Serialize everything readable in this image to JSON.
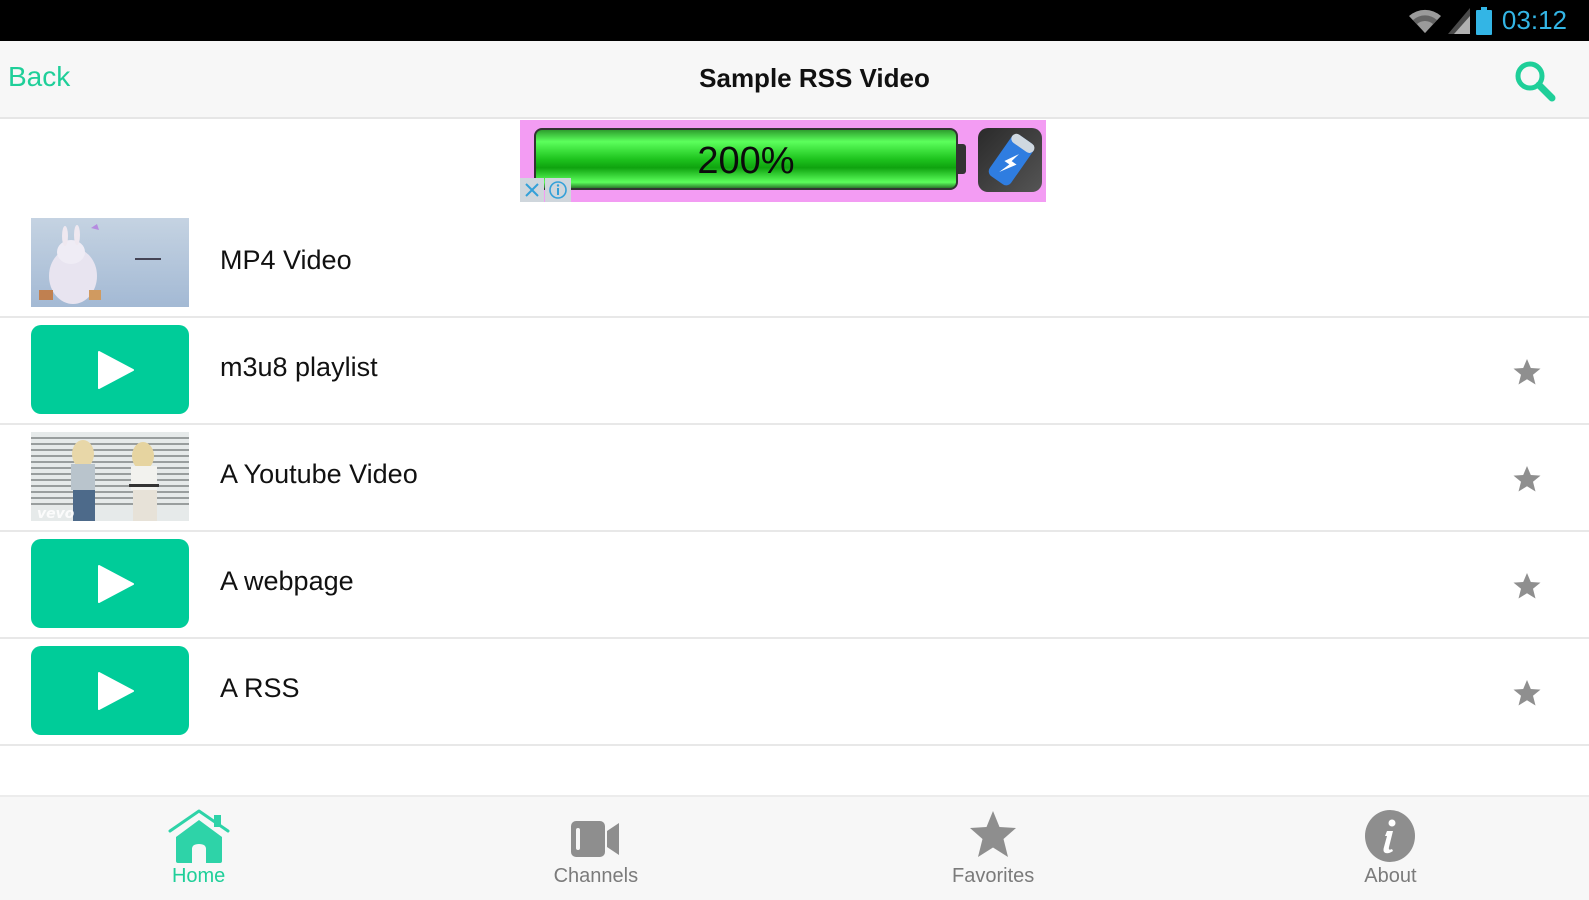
{
  "status_bar": {
    "time": "03:12",
    "icons": [
      "wifi-icon",
      "signal-icon",
      "battery-icon"
    ],
    "time_color": "#33b5e5"
  },
  "app_bar": {
    "back_label": "Back",
    "title": "Sample RSS Video",
    "search_icon": "search-icon",
    "accent_color": "#1fcf99"
  },
  "ad": {
    "text": "200%",
    "close_icon": "close-icon",
    "info_icon": "info-icon",
    "app_icon": "battery-app-icon"
  },
  "list": {
    "items": [
      {
        "title": "MP4 Video",
        "thumbnail": "video-thumbnail-bunny",
        "favorite": false
      },
      {
        "title": "m3u8 playlist",
        "thumbnail": "play-icon",
        "favorite": true
      },
      {
        "title": "A Youtube Video",
        "thumbnail": "video-thumbnail-vevo",
        "favorite": true
      },
      {
        "title": "A webpage",
        "thumbnail": "play-icon",
        "favorite": true
      },
      {
        "title": "A RSS",
        "thumbnail": "play-icon",
        "favorite": true
      }
    ],
    "play_tile_color": "#00cc99",
    "star_color": "#8f8f8f"
  },
  "tabs": [
    {
      "label": "Home",
      "icon": "home-icon",
      "active": true
    },
    {
      "label": "Channels",
      "icon": "video-camera-icon",
      "active": false
    },
    {
      "label": "Favorites",
      "icon": "star-icon",
      "active": false
    },
    {
      "label": "About",
      "icon": "info-icon",
      "active": false
    }
  ]
}
